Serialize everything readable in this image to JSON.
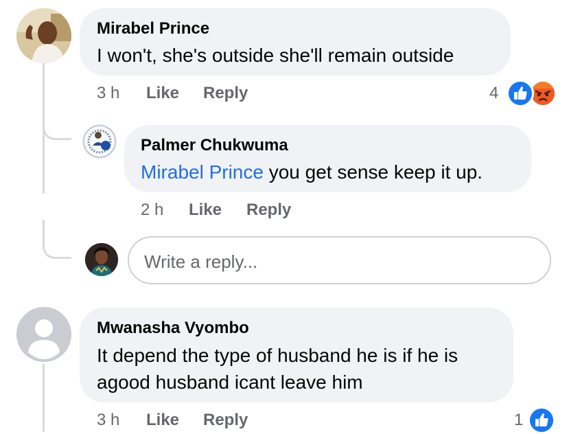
{
  "comments": [
    {
      "author": "Mirabel Prince",
      "text": "I won't, she's outside she'll remain outside",
      "time": "3 h",
      "like_label": "Like",
      "reply_label": "Reply",
      "reaction_count": "4",
      "reactions": [
        "like-icon",
        "angry-icon"
      ]
    },
    {
      "author": "Palmer Chukwuma",
      "mention": "Mirabel Prince",
      "text": " you get sense keep it up.",
      "time": "2 h",
      "like_label": "Like",
      "reply_label": "Reply"
    },
    {
      "author": "Mwanasha Vyombo",
      "text_line1": "It depend the type of husband he is if he is",
      "text_line2": "agood husband icant leave him",
      "time": "3 h",
      "like_label": "Like",
      "reply_label": "Reply",
      "reaction_count": "1",
      "reactions": [
        "like-icon"
      ]
    }
  ],
  "reply_box": {
    "placeholder": "Write a reply..."
  },
  "colors": {
    "bubble": "#f0f2f5",
    "mention": "#216fdb",
    "meta": "#65676b",
    "like": "#1877f2",
    "angry": "#f05a24"
  }
}
